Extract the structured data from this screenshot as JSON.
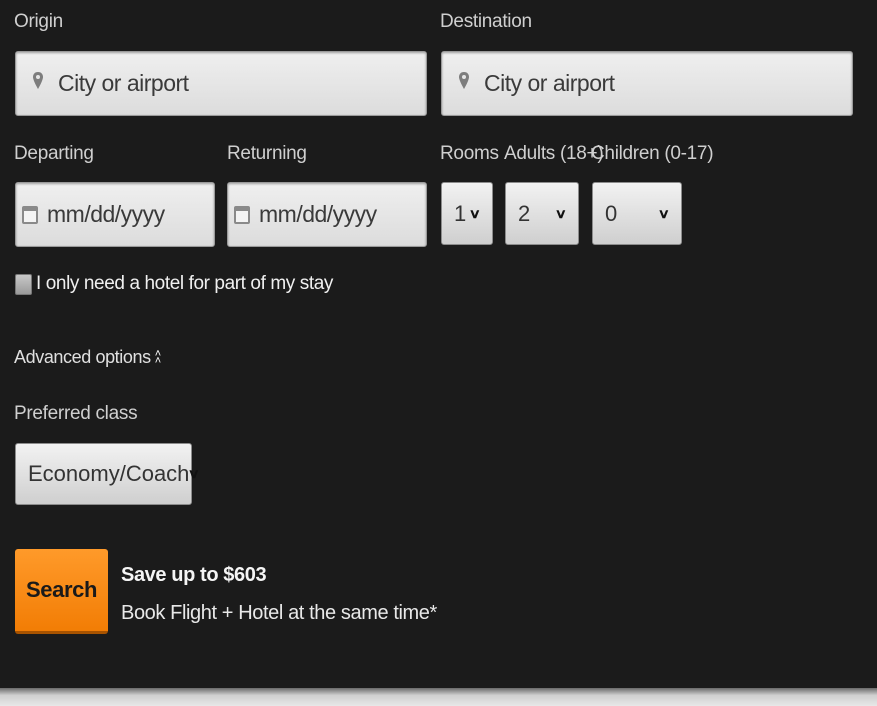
{
  "origin": {
    "label": "Origin",
    "placeholder": "City or airport",
    "icon": "location-pin-icon"
  },
  "destination": {
    "label": "Destination",
    "placeholder": "City or airport",
    "icon": "location-pin-icon"
  },
  "departing": {
    "label": "Departing",
    "placeholder": "mm/dd/yyyy",
    "icon": "calendar-icon"
  },
  "returning": {
    "label": "Returning",
    "placeholder": "mm/dd/yyyy",
    "icon": "calendar-icon"
  },
  "rooms": {
    "label": "Rooms",
    "value": "1"
  },
  "adults": {
    "label": "Adults (18+)",
    "value": "2"
  },
  "children": {
    "label": "Children (0-17)",
    "value": "0"
  },
  "partial_stay": {
    "label": "I only need a hotel for part of my stay",
    "checked": false
  },
  "advanced": {
    "label": "Advanced options",
    "icon": "chevron-up-icon"
  },
  "preferred_class": {
    "label": "Preferred class",
    "value": "Economy/Coach"
  },
  "search": {
    "label": "Search",
    "color": "#f7870f"
  },
  "promo": {
    "title": "Save up to $603",
    "subtitle": "Book Flight + Hotel at the same time*"
  }
}
